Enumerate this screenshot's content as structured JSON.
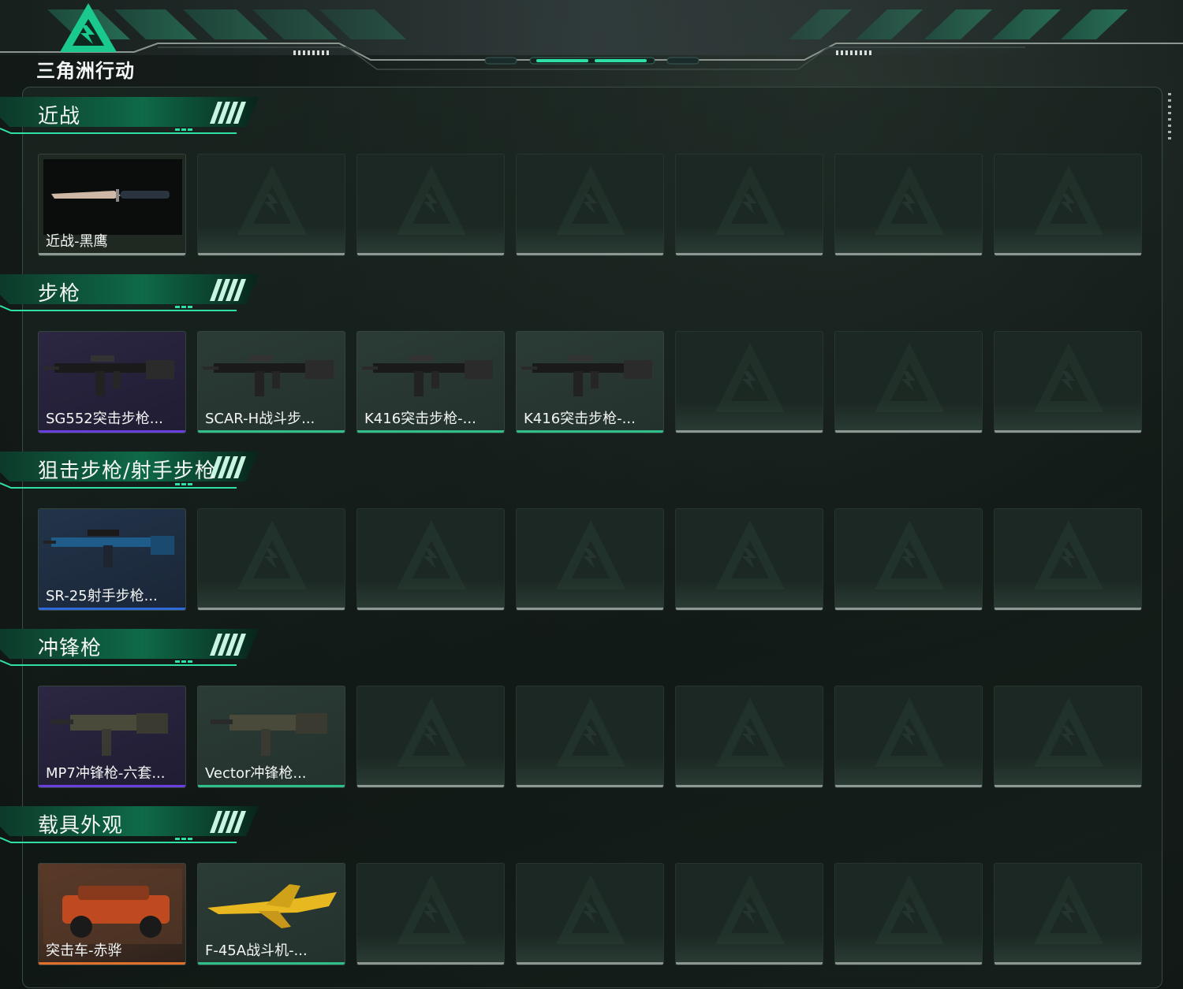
{
  "app": {
    "logo_text": "三角洲行动"
  },
  "colors": {
    "accent": "#1fd19a",
    "rarity_green": "#2fbf8a",
    "rarity_purple": "#6a3fe0",
    "rarity_blue": "#2f6ad8",
    "rarity_orange": "#e0702a",
    "empty_bar": "#8e9893"
  },
  "sections": [
    {
      "title": "近战",
      "items": [
        {
          "name": "近战-黑鹰",
          "rarity": "dark",
          "icon": "knife-icon"
        }
      ]
    },
    {
      "title": "步枪",
      "items": [
        {
          "name": "SG552突击步枪...",
          "rarity": "purple",
          "icon": "rifle-icon"
        },
        {
          "name": "SCAR-H战斗步...",
          "rarity": "green",
          "icon": "rifle-icon"
        },
        {
          "name": "K416突击步枪-...",
          "rarity": "green",
          "icon": "rifle-icon"
        },
        {
          "name": "K416突击步枪-...",
          "rarity": "green",
          "icon": "rifle-icon"
        }
      ]
    },
    {
      "title": "狙击步枪/射手步枪",
      "items": [
        {
          "name": "SR-25射手步枪...",
          "rarity": "blue",
          "icon": "marksman-rifle-icon"
        }
      ]
    },
    {
      "title": "冲锋枪",
      "items": [
        {
          "name": "MP7冲锋枪-六套...",
          "rarity": "purple",
          "icon": "smg-icon"
        },
        {
          "name": "Vector冲锋枪...",
          "rarity": "green",
          "icon": "smg-icon"
        }
      ]
    },
    {
      "title": "载具外观",
      "items": [
        {
          "name": "突击车-赤骅",
          "rarity": "orange",
          "icon": "assault-vehicle-icon"
        },
        {
          "name": "F-45A战斗机-...",
          "rarity": "green",
          "icon": "fighter-jet-icon"
        }
      ]
    }
  ]
}
